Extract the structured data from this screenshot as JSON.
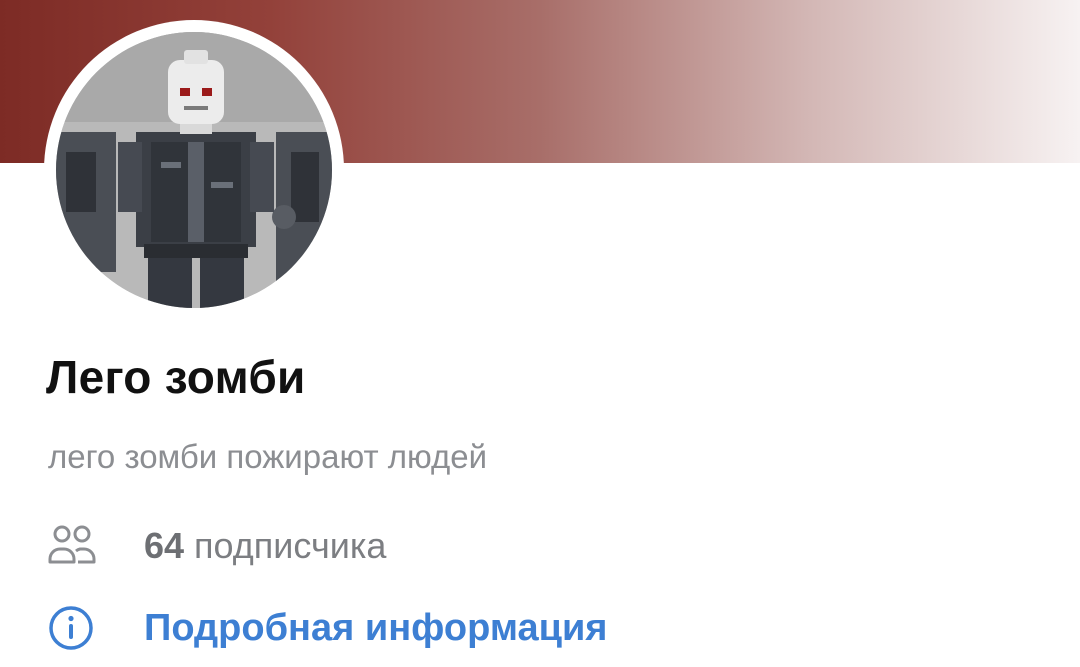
{
  "profile": {
    "name": "Лего зомби",
    "status": "лего зомби пожирают людей",
    "followers_count": "64",
    "followers_label": "подписчика",
    "details_link": "Подробная информация"
  },
  "icons": {
    "avatar": "lego-zombie-minifigures-photo",
    "followers": "people-icon",
    "details": "info-icon"
  },
  "colors": {
    "cover_start": "#7d2b25",
    "cover_end": "#f7f2f2",
    "link": "#3d7fd3",
    "secondary_text": "#8c8e92"
  }
}
